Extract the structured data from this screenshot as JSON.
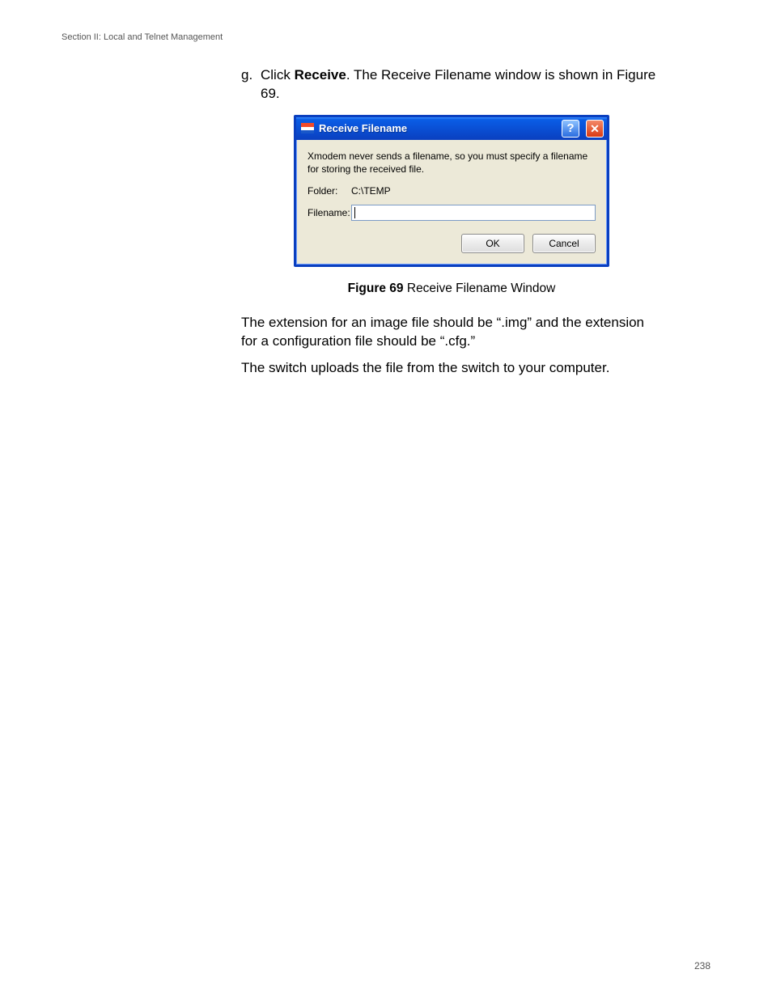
{
  "header": {
    "section": "Section II: Local and Telnet Management"
  },
  "step": {
    "marker": "g.",
    "text_before": "Click ",
    "bold": "Receive",
    "text_after": ". The Receive Filename window is shown in Figure 69."
  },
  "dialog": {
    "title": "Receive Filename",
    "help_glyph": "?",
    "close_glyph": "✕",
    "message": "Xmodem never sends a filename, so you must specify a filename for storing the received file.",
    "folder_label": "Folder:",
    "folder_value": "C:\\TEMP",
    "filename_label": "Filename:",
    "filename_value": "",
    "ok_label": "OK",
    "cancel_label": "Cancel"
  },
  "caption": {
    "bold": "Figure 69",
    "rest": "  Receive Filename Window"
  },
  "para1": "The extension for an image file should be “.img” and the extension for a configuration file should be “.cfg.”",
  "para2": "The switch uploads the file from the switch to your computer.",
  "page_number": "238"
}
